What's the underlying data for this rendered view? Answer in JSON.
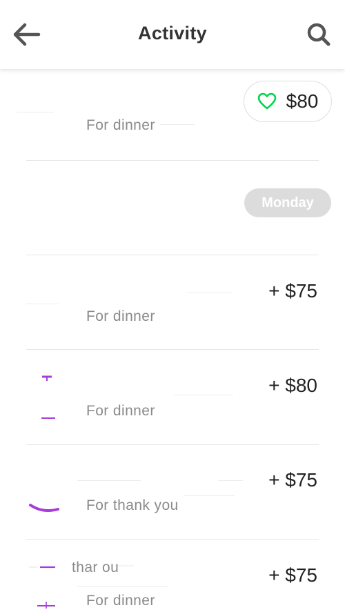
{
  "header": {
    "title": "Activity",
    "back_icon": "arrow-left-icon",
    "search_icon": "search-icon"
  },
  "colors": {
    "accent_green": "#00d64f",
    "purple": "#a63cd9",
    "chip_bg": "#dcdcdc",
    "muted_text": "#8a8a8a"
  },
  "feed": {
    "top_item": {
      "like_amount": "$80",
      "note": "For dinner",
      "icon": "heart-outline-icon"
    },
    "day_separator": "Monday",
    "items": [
      {
        "amount": "+ $75",
        "note": "For dinner"
      },
      {
        "amount": "+ $80",
        "note": "For dinner"
      },
      {
        "amount": "+ $75",
        "note": "For thank you"
      },
      {
        "amount": "+ $75",
        "note": "For dinner",
        "extra_text": "thar ou"
      }
    ]
  }
}
